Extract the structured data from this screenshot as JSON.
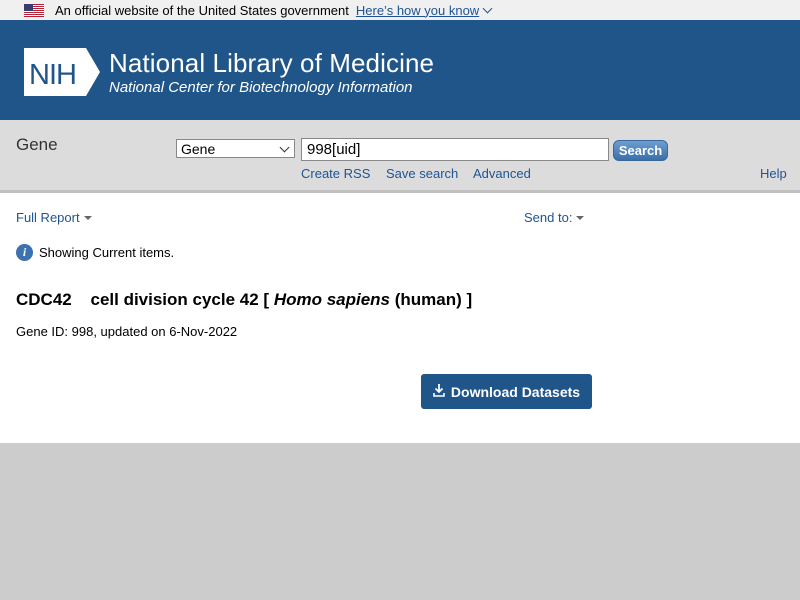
{
  "gov_banner": {
    "text": "An official website of the United States government",
    "link": "Here’s how you know"
  },
  "header": {
    "logo_text": "NIH",
    "title": "National Library of Medicine",
    "subtitle": "National Center for Biotechnology Information"
  },
  "search": {
    "db_title": "Gene",
    "db_selected": "Gene",
    "term": "998[uid]",
    "button": "Search",
    "links": [
      "Create RSS",
      "Save search",
      "Advanced"
    ],
    "help": "Help"
  },
  "toolbar": {
    "full_report": "Full Report",
    "send_to": "Send to:"
  },
  "info": {
    "message": "Showing Current items."
  },
  "gene": {
    "symbol": "CDC42",
    "name_pre": "cell division cycle 42 [",
    "organism": "Homo sapiens",
    "name_post": "(human) ]",
    "id_line": "Gene ID: 998, updated on 6-Nov-2022"
  },
  "download": {
    "label": "Download Datasets"
  },
  "colors": {
    "header_bg": "#20558a",
    "link": "#205493",
    "button_bg": "#20558a"
  }
}
